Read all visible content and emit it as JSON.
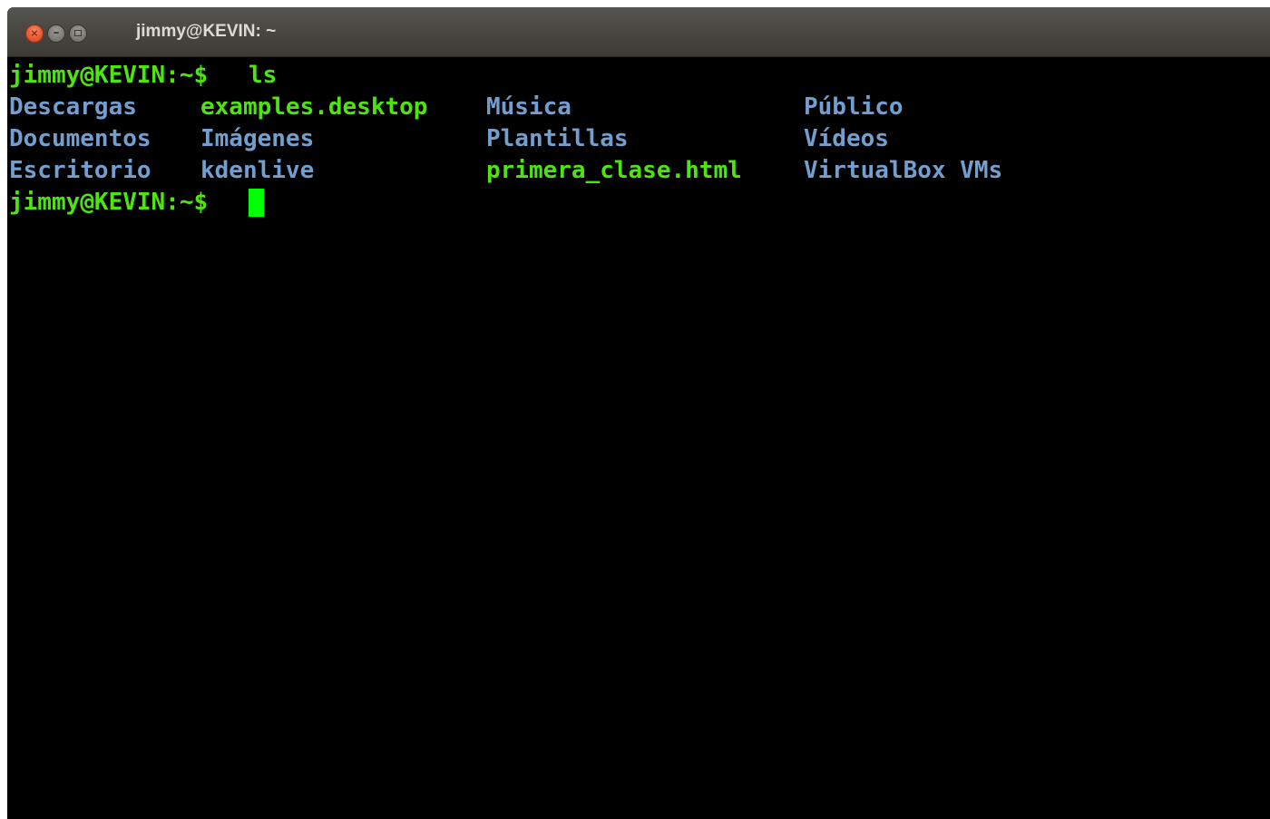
{
  "window": {
    "title": "jimmy@KEVIN: ~",
    "close_glyph": "×",
    "minimize_glyph": "–"
  },
  "terminal": {
    "prompt": "jimmy@KEVIN:~$",
    "command": "ls",
    "listing": [
      [
        "Descargas",
        "examples.desktop",
        "Música",
        "Público"
      ],
      [
        "Documentos",
        "Imágenes",
        "Plantillas",
        "Vídeos"
      ],
      [
        "Escritorio",
        "kdenlive",
        "primera_clase.html",
        "VirtualBox VMs"
      ]
    ],
    "colors": {
      "prompt": "#4ee40f",
      "directory": "#729fcf",
      "file": "#4ee40f",
      "cursor": "#00ff00",
      "background": "#000000"
    }
  }
}
